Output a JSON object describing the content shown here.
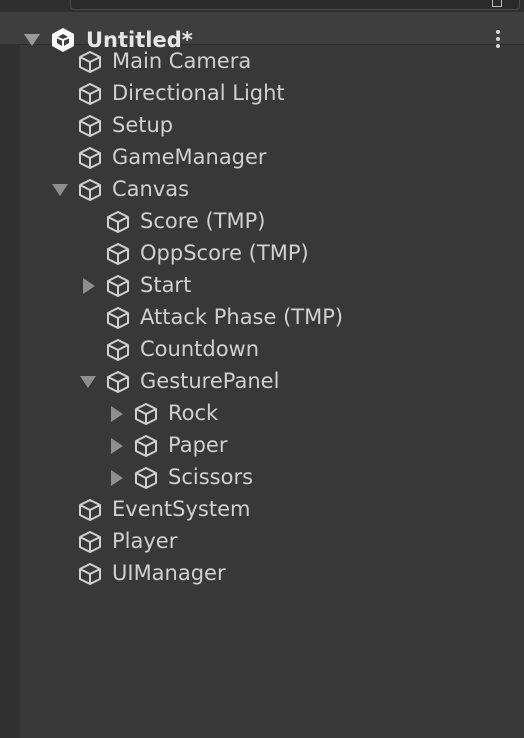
{
  "scene": {
    "title": "Untitled*"
  },
  "hierarchy": [
    {
      "label": "Main Camera"
    },
    {
      "label": "Directional Light"
    },
    {
      "label": "Setup"
    },
    {
      "label": "GameManager"
    },
    {
      "label": "Canvas"
    },
    {
      "label": "Score (TMP)"
    },
    {
      "label": "OppScore (TMP)"
    },
    {
      "label": "Start"
    },
    {
      "label": "Attack Phase (TMP)"
    },
    {
      "label": "Countdown"
    },
    {
      "label": "GesturePanel"
    },
    {
      "label": "Rock"
    },
    {
      "label": "Paper"
    },
    {
      "label": "Scissors"
    },
    {
      "label": "EventSystem"
    },
    {
      "label": "Player"
    },
    {
      "label": "UIManager"
    }
  ]
}
